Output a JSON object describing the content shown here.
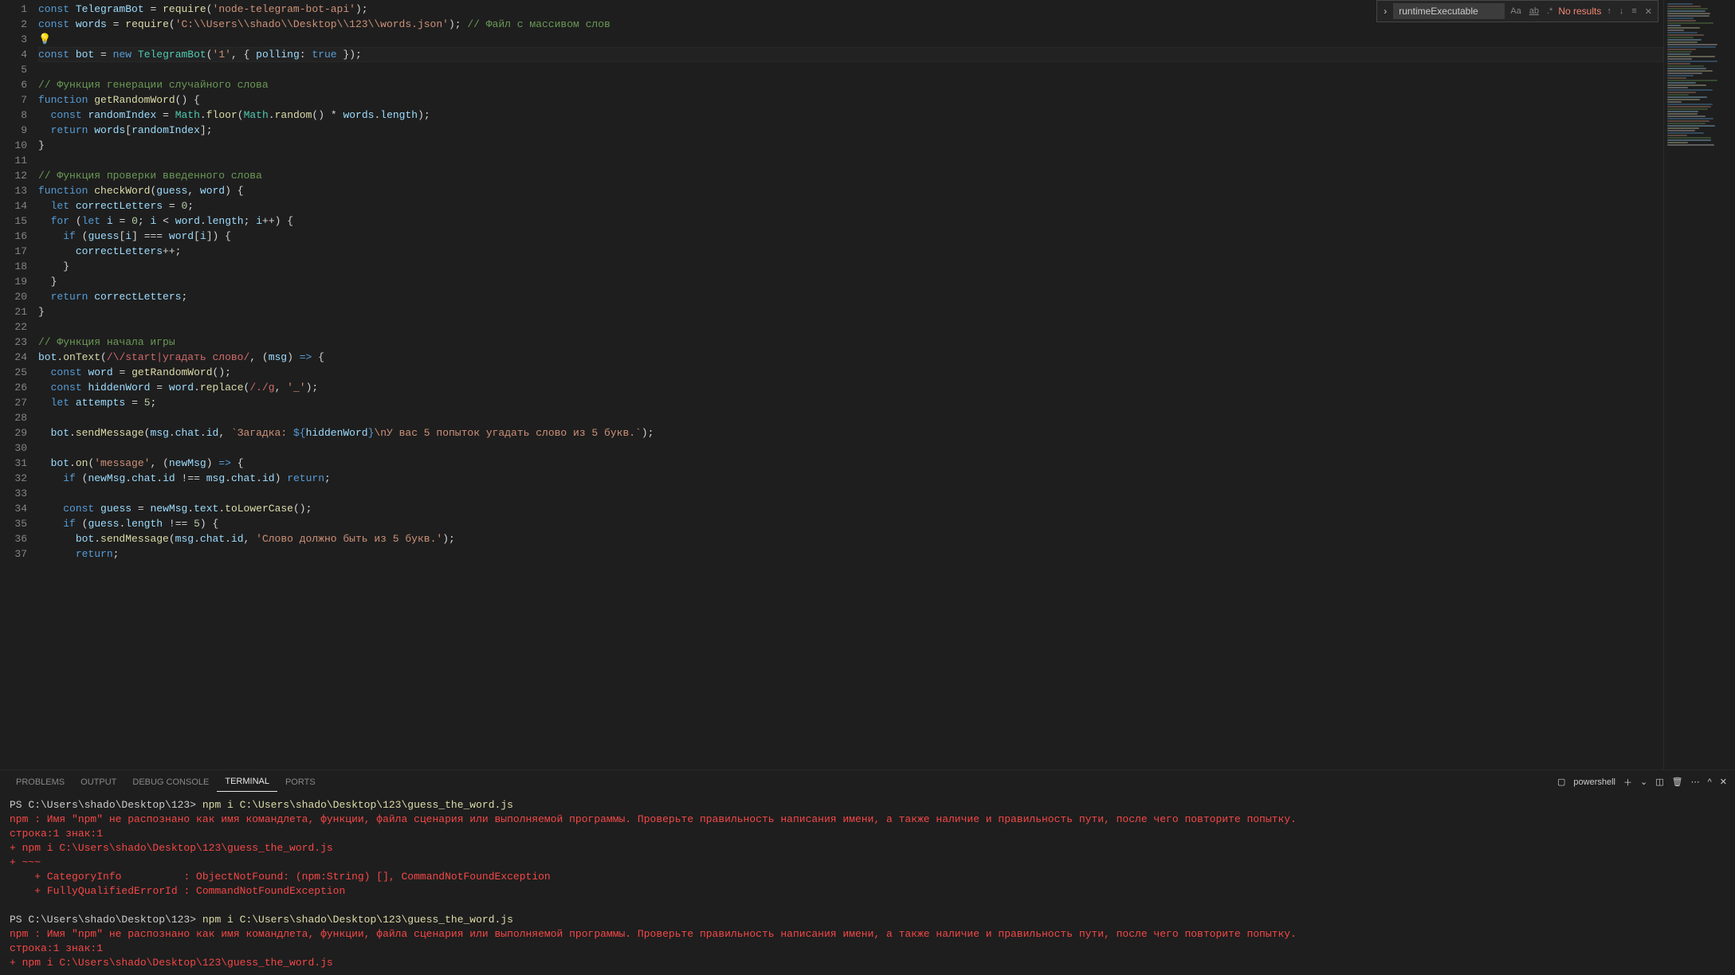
{
  "find": {
    "value": "runtimeExecutable",
    "results_label": "No results"
  },
  "panel": {
    "tabs": [
      "PROBLEMS",
      "OUTPUT",
      "DEBUG CONSOLE",
      "TERMINAL",
      "PORTS"
    ],
    "active_tab": "TERMINAL",
    "shell_label": "powershell"
  },
  "code_lines": [
    {
      "n": 1,
      "html": "<span class='kw'>const</span> <span class='var'>TelegramBot</span> <span class='op'>=</span> <span class='fn'>require</span>(<span class='str'>'node-telegram-bot-api'</span>);"
    },
    {
      "n": 2,
      "html": "<span class='kw'>const</span> <span class='var'>words</span> <span class='op'>=</span> <span class='fn'>require</span>(<span class='str'>'C:\\\\Users\\\\shado\\\\Desktop\\\\123\\\\words.json'</span>); <span class='cmt'>// Файл с массивом слов</span>"
    },
    {
      "n": 3,
      "html": "<span class='lightbulb'>💡</span>"
    },
    {
      "n": 4,
      "html": "<span class='kw'>const</span> <span class='var'>bot</span> <span class='op'>=</span> <span class='kw'>new</span> <span class='cls'>TelegramBot</span>(<span class='str'>'1'</span>, { <span class='prop'>polling</span>: <span class='const'>true</span> });"
    },
    {
      "n": 5,
      "html": ""
    },
    {
      "n": 6,
      "html": "<span class='cmt'>// Функция генерации случайного слова</span>"
    },
    {
      "n": 7,
      "html": "<span class='kw'>function</span> <span class='fn'>getRandomWord</span>() {"
    },
    {
      "n": 8,
      "html": "  <span class='kw'>const</span> <span class='var'>randomIndex</span> <span class='op'>=</span> <span class='cls'>Math</span>.<span class='fn'>floor</span>(<span class='cls'>Math</span>.<span class='fn'>random</span>() <span class='op'>*</span> <span class='var'>words</span>.<span class='prop'>length</span>);"
    },
    {
      "n": 9,
      "html": "  <span class='kw'>return</span> <span class='var'>words</span>[<span class='var'>randomIndex</span>];"
    },
    {
      "n": 10,
      "html": "}"
    },
    {
      "n": 11,
      "html": ""
    },
    {
      "n": 12,
      "html": "<span class='cmt'>// Функция проверки введенного слова</span>"
    },
    {
      "n": 13,
      "html": "<span class='kw'>function</span> <span class='fn'>checkWord</span>(<span class='var'>guess</span>, <span class='var'>word</span>) {"
    },
    {
      "n": 14,
      "html": "  <span class='kw'>let</span> <span class='var'>correctLetters</span> <span class='op'>=</span> <span class='num'>0</span>;"
    },
    {
      "n": 15,
      "html": "  <span class='kw'>for</span> (<span class='kw'>let</span> <span class='var'>i</span> <span class='op'>=</span> <span class='num'>0</span>; <span class='var'>i</span> <span class='op'>&lt;</span> <span class='var'>word</span>.<span class='prop'>length</span>; <span class='var'>i</span><span class='op'>++</span>) {"
    },
    {
      "n": 16,
      "html": "    <span class='kw'>if</span> (<span class='var'>guess</span>[<span class='var'>i</span>] <span class='op'>===</span> <span class='var'>word</span>[<span class='var'>i</span>]) {"
    },
    {
      "n": 17,
      "html": "      <span class='var'>correctLetters</span><span class='op'>++</span>;"
    },
    {
      "n": 18,
      "html": "    }"
    },
    {
      "n": 19,
      "html": "  }"
    },
    {
      "n": 20,
      "html": "  <span class='kw'>return</span> <span class='var'>correctLetters</span>;"
    },
    {
      "n": 21,
      "html": "}"
    },
    {
      "n": 22,
      "html": ""
    },
    {
      "n": 23,
      "html": "<span class='cmt'>// Функция начала игры</span>"
    },
    {
      "n": 24,
      "html": "<span class='var'>bot</span>.<span class='fn'>onText</span>(<span class='regex'>/\\/start|угадать слово/</span>, (<span class='var'>msg</span>) <span class='kw'>=&gt;</span> {"
    },
    {
      "n": 25,
      "html": "  <span class='kw'>const</span> <span class='var'>word</span> <span class='op'>=</span> <span class='fn'>getRandomWord</span>();"
    },
    {
      "n": 26,
      "html": "  <span class='kw'>const</span> <span class='var'>hiddenWord</span> <span class='op'>=</span> <span class='var'>word</span>.<span class='fn'>replace</span>(<span class='regex'>/./g</span>, <span class='str'>'_'</span>);"
    },
    {
      "n": 27,
      "html": "  <span class='kw'>let</span> <span class='var'>attempts</span> <span class='op'>=</span> <span class='num'>5</span>;"
    },
    {
      "n": 28,
      "html": ""
    },
    {
      "n": 29,
      "html": "  <span class='var'>bot</span>.<span class='fn'>sendMessage</span>(<span class='var'>msg</span>.<span class='prop'>chat</span>.<span class='prop'>id</span>, <span class='str'>`Загадка: </span><span class='kw'>${</span><span class='var'>hiddenWord</span><span class='kw'>}</span><span class='str'>\\nУ вас 5 попыток угадать слово из 5 букв.`</span>);"
    },
    {
      "n": 30,
      "html": ""
    },
    {
      "n": 31,
      "html": "  <span class='var'>bot</span>.<span class='fn'>on</span>(<span class='str'>'message'</span>, (<span class='var'>newMsg</span>) <span class='kw'>=&gt;</span> {"
    },
    {
      "n": 32,
      "html": "    <span class='kw'>if</span> (<span class='var'>newMsg</span>.<span class='prop'>chat</span>.<span class='prop'>id</span> <span class='op'>!==</span> <span class='var'>msg</span>.<span class='prop'>chat</span>.<span class='prop'>id</span>) <span class='kw'>return</span>;"
    },
    {
      "n": 33,
      "html": ""
    },
    {
      "n": 34,
      "html": "    <span class='kw'>const</span> <span class='var'>guess</span> <span class='op'>=</span> <span class='var'>newMsg</span>.<span class='prop'>text</span>.<span class='fn'>toLowerCase</span>();"
    },
    {
      "n": 35,
      "html": "    <span class='kw'>if</span> (<span class='var'>guess</span>.<span class='prop'>length</span> <span class='op'>!==</span> <span class='num'>5</span>) {"
    },
    {
      "n": 36,
      "html": "      <span class='var'>bot</span>.<span class='fn'>sendMessage</span>(<span class='var'>msg</span>.<span class='prop'>chat</span>.<span class='prop'>id</span>, <span class='str'>'Слово должно быть из 5 букв.'</span>);"
    },
    {
      "n": 37,
      "html": "      <span class='kw'>return</span>;"
    }
  ],
  "terminal_lines": [
    {
      "cls": "t-default",
      "prefix": "PS C:\\Users\\shado\\Desktop\\123> ",
      "cmd": "npm i C:\\Users\\shado\\Desktop\\123\\guess_the_word.js",
      "cmd_cls": "t-yellow"
    },
    {
      "cls": "t-red",
      "text": "npm : Имя \"npm\" не распознано как имя командлета, функции, файла сценария или выполняемой программы. Проверьте правильность написания имени, а также наличие и правильность пути, после чего повторите попытку."
    },
    {
      "cls": "t-red",
      "text": "строка:1 знак:1"
    },
    {
      "cls": "t-red",
      "text": "+ npm i C:\\Users\\shado\\Desktop\\123\\guess_the_word.js"
    },
    {
      "cls": "t-red",
      "text": "+ ~~~"
    },
    {
      "cls": "t-red",
      "text": "    + CategoryInfo          : ObjectNotFound: (npm:String) [], CommandNotFoundException"
    },
    {
      "cls": "t-red",
      "text": "    + FullyQualifiedErrorId : CommandNotFoundException"
    },
    {
      "cls": "t-default",
      "text": " "
    },
    {
      "cls": "t-default",
      "prefix": "PS C:\\Users\\shado\\Desktop\\123> ",
      "cmd": "npm i C:\\Users\\shado\\Desktop\\123\\guess_the_word.js",
      "cmd_cls": "t-yellow"
    },
    {
      "cls": "t-red",
      "text": "npm : Имя \"npm\" не распознано как имя командлета, функции, файла сценария или выполняемой программы. Проверьте правильность написания имени, а также наличие и правильность пути, после чего повторите попытку."
    },
    {
      "cls": "t-red",
      "text": "строка:1 знак:1"
    },
    {
      "cls": "t-red",
      "text": "+ npm i C:\\Users\\shado\\Desktop\\123\\guess_the_word.js"
    }
  ]
}
